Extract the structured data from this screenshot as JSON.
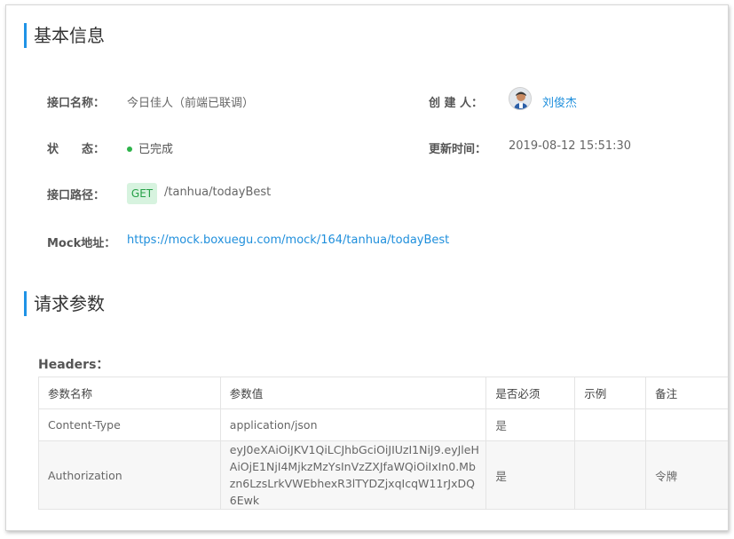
{
  "basic_info": {
    "title": "基本信息",
    "api_name_label": "接口名称：",
    "api_name_value": "今日佳人（前端已联调）",
    "creator_label": "创 建 人：",
    "creator_name": "刘俊杰",
    "status_label": "状　　态：",
    "status_value": "已完成",
    "status_color": "#2db34a",
    "updated_label": "更新时间：",
    "updated_value": "2019-08-12 15:51:30",
    "path_label": "接口路径：",
    "method": "GET",
    "path_value": "/tanhua/todayBest",
    "mock_label": "Mock地址：",
    "mock_url": "https://mock.boxuegu.com/mock/164/tanhua/todayBest"
  },
  "request_params": {
    "title": "请求参数",
    "headers_label": "Headers：",
    "columns": [
      "参数名称",
      "参数值",
      "是否必须",
      "示例",
      "备注"
    ],
    "rows": [
      {
        "name": "Content-Type",
        "value": "application/json",
        "required": "是",
        "example": "",
        "note": ""
      },
      {
        "name": "Authorization",
        "value": "eyJ0eXAiOiJKV1QiLCJhbGciOiJIUzI1NiJ9.eyJleHAiOjE1NjI4MjkzMzYsInVzZXJfaWQiOiIxIn0.Mbzn6LzsLrkVWEbhexR3lTYDZjxqIcqW11rJxDQ6Ewk",
        "required": "是",
        "example": "",
        "note": "令牌"
      }
    ]
  },
  "colors": {
    "accent": "#1f93e6",
    "link": "#1f8fdc",
    "get_tag_bg": "#d7f3df",
    "get_tag_text": "#26a047"
  },
  "icons": {
    "avatar": "user-avatar-icon",
    "status": "status-dot-icon"
  }
}
